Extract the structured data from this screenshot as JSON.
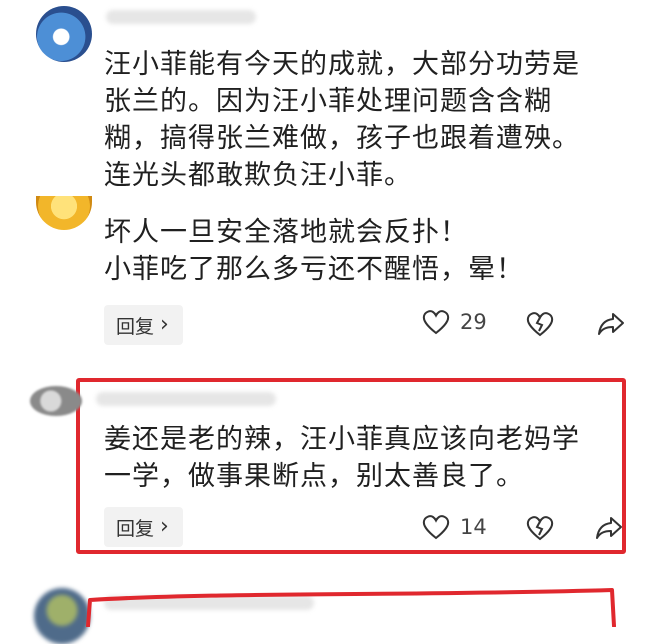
{
  "comments": [
    {
      "lines": [
        "汪小菲能有今天的成就，大部分功劳是",
        "张兰的。因为汪小菲处理问题含含糊",
        "糊，搞得张兰难做，孩子也跟着遭殃。",
        "连光头都敢欺负汪小菲。"
      ]
    },
    {
      "lines": [
        "坏人一旦安全落地就会反扑！",
        "小菲吃了那么多亏还不醒悟，晕！"
      ],
      "reply_label": "回复",
      "like_count": "29"
    },
    {
      "lines": [
        "姜还是老的辣，汪小菲真应该向老妈学",
        "一学，做事果断点，别太善良了。"
      ],
      "reply_label": "回复",
      "like_count": "14"
    }
  ],
  "colors": {
    "highlight": "#e0282e"
  },
  "icons": [
    "heart-icon",
    "broken-heart-icon",
    "share-icon",
    "chevron-right-icon"
  ]
}
